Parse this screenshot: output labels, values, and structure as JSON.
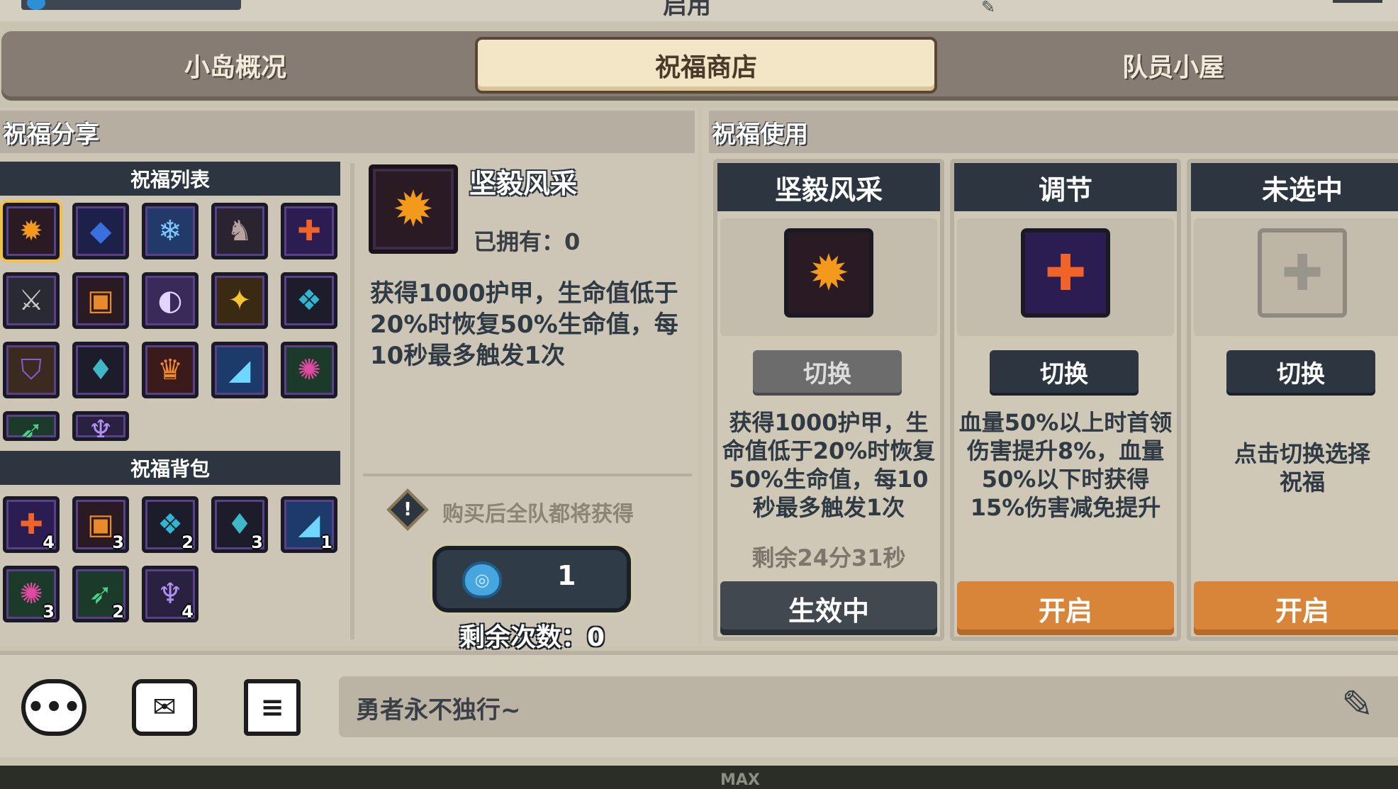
{
  "header": {
    "title_partial": "启用"
  },
  "tabs": [
    {
      "label": "小岛概况",
      "active": false
    },
    {
      "label": "祝福商店",
      "active": true
    },
    {
      "label": "队员小屋",
      "active": false
    }
  ],
  "left": {
    "section_title": "祝福分享",
    "list_title": "祝福列表",
    "bag_title": "祝福背包",
    "list_icons": [
      "sunburst-icon",
      "moon-crystal-icon",
      "frost-shield-icon",
      "dragon-head-icon",
      "cross-star-icon",
      "crossed-swords-icon",
      "fire-chest-icon",
      "moon-orb-icon",
      "gold-nugget-icon",
      "gem-cluster-icon",
      "shield-banner-icon",
      "potion-trio-icon",
      "flame-crown-icon",
      "ice-shard-icon",
      "green-spike-orb-icon",
      "green-arrow-icon",
      "purple-demon-icon"
    ],
    "bag_items": [
      {
        "icon": "cross-star-icon",
        "count": "4"
      },
      {
        "icon": "fire-chest-icon",
        "count": "3"
      },
      {
        "icon": "gem-cluster-icon",
        "count": "2"
      },
      {
        "icon": "potion-trio-icon",
        "count": "3"
      },
      {
        "icon": "ice-shard-icon",
        "count": "1"
      },
      {
        "icon": "green-spike-orb-icon",
        "count": "3"
      },
      {
        "icon": "green-arrow-icon",
        "count": "2"
      },
      {
        "icon": "purple-demon-icon",
        "count": "4"
      }
    ],
    "detail": {
      "name": "坚毅风采",
      "owned": "已拥有：0",
      "desc": "获得1000护甲，生命值低于20%时恢复50%生命值，每10秒最多触发1次",
      "notice": "购买后全队都将获得",
      "price": "1",
      "remaining": "剩余次数：0"
    }
  },
  "right": {
    "section_title": "祝福使用",
    "cards": [
      {
        "title": "坚毅风采",
        "icon": "sunburst-icon",
        "swap_label": "切换",
        "swap_disabled": true,
        "desc": "获得1000护甲，生命值低于20%时恢复50%生命值，每10秒最多触发1次",
        "timer": "剩余24分31秒",
        "action": "生效中"
      },
      {
        "title": "调节",
        "icon": "cross-star-icon",
        "swap_label": "切换",
        "swap_disabled": false,
        "desc": "血量50%以上时首领伤害提升8%，血量50%以下时获得15%伤害减免提升",
        "timer": "",
        "action": "开启"
      },
      {
        "title": "未选中",
        "icon": "empty-plus-icon",
        "swap_label": "切换",
        "swap_disabled": false,
        "desc": "点击切换选择祝福",
        "timer": "",
        "action": "开启"
      }
    ]
  },
  "bottom": {
    "chat_placeholder": "勇者永不独行~",
    "footer_label": "MAX"
  },
  "colors": {
    "panel_bg": "#cdc6b6",
    "header_dark": "#2c3540",
    "active_tab": "#f3e6c7",
    "open_button": "#d8853a",
    "active_button": "#414850"
  }
}
